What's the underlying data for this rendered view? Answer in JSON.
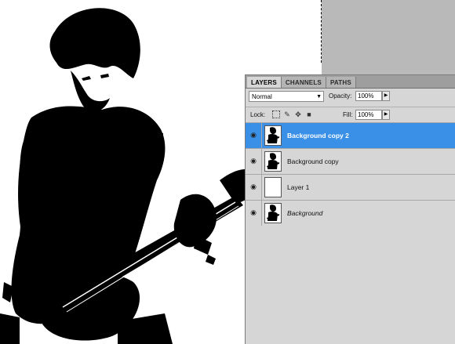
{
  "panel": {
    "tabs": [
      {
        "label": "LAYERS",
        "active": true
      },
      {
        "label": "CHANNELS",
        "active": false
      },
      {
        "label": "PATHS",
        "active": false
      }
    ],
    "blend_mode": "Normal",
    "opacity_label": "Opacity:",
    "opacity_value": "100%",
    "lock_label": "Lock:",
    "fill_label": "Fill:",
    "fill_value": "100%",
    "layers": [
      {
        "name": "Background copy 2",
        "selected": true,
        "visible": true,
        "thumbnail": "guitarist-image",
        "italic": false
      },
      {
        "name": "Background copy",
        "selected": false,
        "visible": true,
        "thumbnail": "guitarist-image",
        "italic": false
      },
      {
        "name": "Layer 1",
        "selected": false,
        "visible": true,
        "thumbnail": "blank",
        "italic": false
      },
      {
        "name": "Background",
        "selected": false,
        "visible": true,
        "thumbnail": "guitarist-image",
        "italic": true
      }
    ]
  },
  "colors": {
    "selected_row": "#3a8fe6",
    "canvas_gray": "#b9b9b9",
    "panel_bg": "#d6d6d6"
  }
}
